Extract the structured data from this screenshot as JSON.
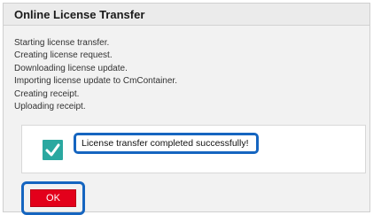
{
  "dialog": {
    "title": "Online License Transfer",
    "log": [
      "Starting license transfer.",
      "Creating license request.",
      "Downloading license update.",
      "Importing license update to CmContainer.",
      "Creating receipt.",
      "Uploading receipt."
    ],
    "result": {
      "icon": "check-icon",
      "message": "License transfer completed successfully!"
    },
    "ok_label": "OK"
  },
  "colors": {
    "accent_red": "#e3001b",
    "highlight_blue": "#1565c0",
    "check_teal": "#2aa8a0"
  }
}
